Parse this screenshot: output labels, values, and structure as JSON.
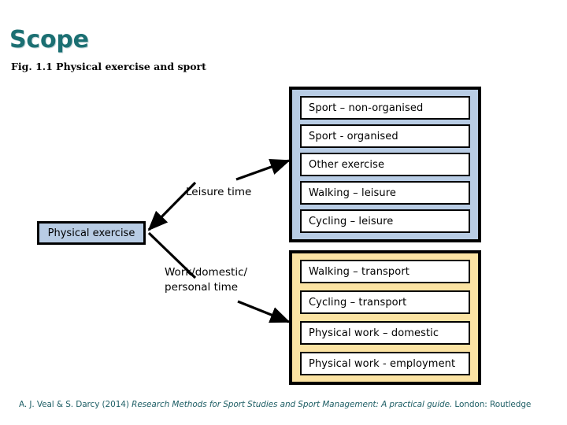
{
  "slide": {
    "title": "Scope",
    "title_color": "#1b6f72",
    "caption": "Fig. 1.1 Physical exercise and sport"
  },
  "diagram": {
    "source_node": {
      "label": "Physical exercise",
      "fill": "#b8cce4"
    },
    "branches": [
      {
        "label": "Leisure time"
      },
      {
        "label_line1": "Work/domestic/",
        "label_line2": "personal time"
      }
    ],
    "groups": [
      {
        "name": "leisure-time-group",
        "fill": "#b8cce4",
        "items": [
          "Sport – non-organised",
          "Sport - organised",
          "Other exercise",
          "Walking – leisure",
          "Cycling – leisure"
        ]
      },
      {
        "name": "work-domestic-personal-time-group",
        "fill": "#fbe3a3",
        "items": [
          "Walking – transport",
          "Cycling – transport",
          "Physical work – domestic",
          "Physical work - employment"
        ]
      }
    ]
  },
  "footer": {
    "authors_year": "A. J. Veal & S. Darcy (2014) ",
    "book_title": "Research Methods for Sport Studies and Sport Management: A practical guide.",
    "publisher": " London: Routledge",
    "color": "#1f5f66"
  }
}
